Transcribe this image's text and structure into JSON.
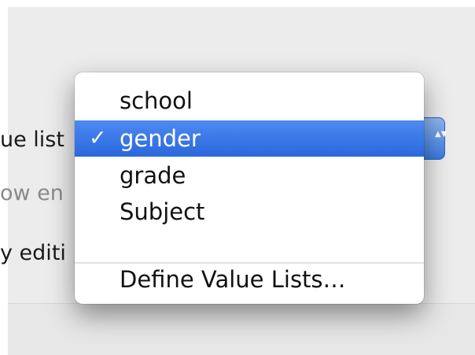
{
  "background": {
    "labels": [
      {
        "text": "ue list",
        "faded": false
      },
      {
        "text": "ow en",
        "faded": true
      },
      {
        "text": "y editi",
        "faded": false
      }
    ],
    "popup_arrows": "▲▼"
  },
  "menu": {
    "items": [
      {
        "label": "school",
        "checked": false,
        "selected": false
      },
      {
        "label": "gender",
        "checked": true,
        "selected": true
      },
      {
        "label": "grade",
        "checked": false,
        "selected": false
      },
      {
        "label": "Subject",
        "checked": false,
        "selected": false
      }
    ],
    "checkmark": "✓",
    "footer_item": "Define Value Lists…"
  },
  "colors": {
    "selection": "#3a78e6",
    "panel": "#ececec"
  }
}
